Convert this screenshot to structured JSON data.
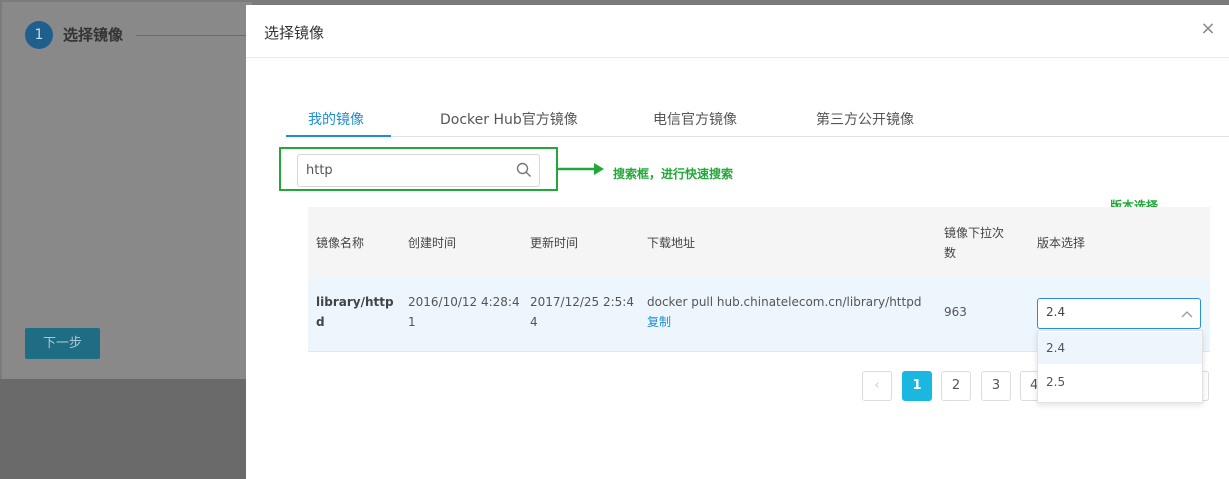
{
  "background": {
    "step_number": "1",
    "step_label": "选择镜像",
    "next_button": "下一步"
  },
  "modal": {
    "title": "选择镜像",
    "close_icon": "×",
    "tabs": [
      {
        "label": "我的镜像",
        "active": true
      },
      {
        "label": "Docker Hub官方镜像",
        "active": false
      },
      {
        "label": "电信官方镜像",
        "active": false
      },
      {
        "label": "第三方公开镜像",
        "active": false
      }
    ],
    "search": {
      "value": "http",
      "icon": "search-icon"
    },
    "annotations": {
      "search_note": "搜索框，进行快速搜索",
      "version_note": "版本选择",
      "color": "#22a83a"
    },
    "table": {
      "headers": {
        "name": "镜像名称",
        "created": "创建时间",
        "updated": "更新时间",
        "download": "下载地址",
        "pulls_line1": "镜像下拉次",
        "pulls_line2": "数",
        "version": "版本选择"
      },
      "rows": [
        {
          "name_line1": "library/http",
          "name_line2": "d",
          "created_line1": "2016/10/12 4:28:4",
          "created_line2": "1",
          "updated_line1": "2017/12/25 2:5:4",
          "updated_line2": "4",
          "download": "docker pull hub.chinatelecom.cn/library/httpd",
          "copy": "复制",
          "pulls": "963",
          "version": "2.4"
        }
      ]
    },
    "version_options": [
      "2.4",
      "2.5"
    ],
    "pagination": {
      "prev_icon": "‹",
      "pages": [
        "1",
        "2",
        "3",
        "4"
      ],
      "current": "1"
    },
    "colors": {
      "accent": "#1f8ed4",
      "page_active": "#1ab8e0"
    }
  }
}
